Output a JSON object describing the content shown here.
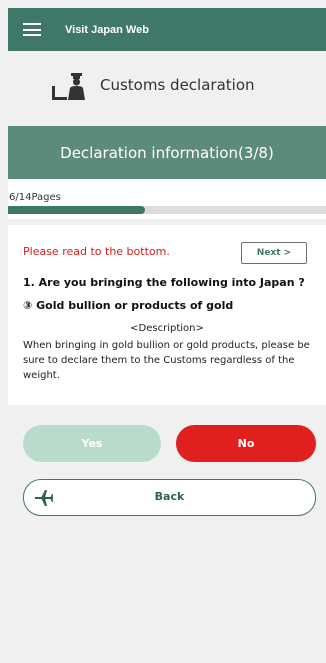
{
  "header": {
    "app_title": "Visit Japan Web"
  },
  "customs": {
    "title": "Customs declaration"
  },
  "section": {
    "title": "Declaration information(3/8)"
  },
  "progress": {
    "label": "6/14Pages",
    "fraction": 0.43
  },
  "content": {
    "notice": "Please read to the bottom.",
    "next_label": "Next >",
    "question": "1. Are you bringing the following into Japan ?",
    "item": "③ Gold bullion or products of gold",
    "description_heading": "<Description>",
    "description_body": "When bringing in gold bullion or gold products, please be sure to declare them to the Customs regardless of the weight."
  },
  "actions": {
    "yes_label": "Yes",
    "no_label": "No",
    "back_label": "Back"
  },
  "colors": {
    "brand": "#3f7868",
    "band": "#5c8a7b",
    "no": "#e01f1f",
    "yes_disabled": "#b9dbcc",
    "notice": "#d51e1e"
  },
  "icons": {
    "menu": "hamburger-menu-icon",
    "customs": "customs-officer-icon",
    "back": "airplane-icon"
  }
}
